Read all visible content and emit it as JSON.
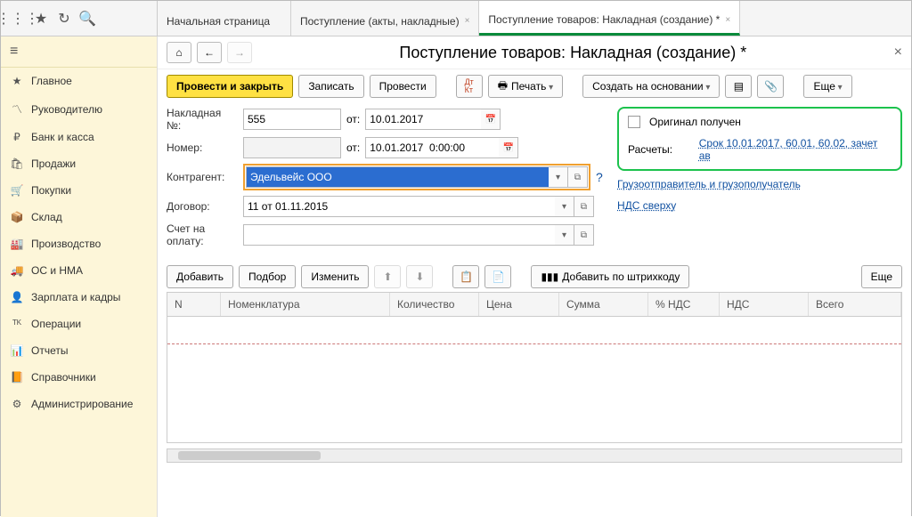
{
  "topTabs": {
    "t0": "Начальная страница",
    "t1": "Поступление (акты, накладные)",
    "t2": "Поступление товаров: Накладная (создание) *"
  },
  "sidebar": {
    "items": [
      {
        "label": "Главное"
      },
      {
        "label": "Руководителю"
      },
      {
        "label": "Банк и касса"
      },
      {
        "label": "Продажи"
      },
      {
        "label": "Покупки"
      },
      {
        "label": "Склад"
      },
      {
        "label": "Производство"
      },
      {
        "label": "ОС и НМА"
      },
      {
        "label": "Зарплата и кадры"
      },
      {
        "label": "Операции"
      },
      {
        "label": "Отчеты"
      },
      {
        "label": "Справочники"
      },
      {
        "label": "Администрирование"
      }
    ]
  },
  "page": {
    "title": "Поступление товаров: Накладная (создание) *"
  },
  "toolbar": {
    "postClose": "Провести и закрыть",
    "save": "Записать",
    "post": "Провести",
    "print": "Печать",
    "createBased": "Создать на основании",
    "more": "Еще"
  },
  "form": {
    "invoiceNoLabel": "Накладная №:",
    "invoiceNo": "555",
    "from1": "от:",
    "date1": "10.01.2017",
    "numberLabel": "Номер:",
    "from2": "от:",
    "date2": "10.01.2017  0:00:00",
    "contractorLabel": "Контрагент:",
    "contractor": "Эдельвейс ООО",
    "contractLabel": "Договор:",
    "contract": "11 от 01.11.2015",
    "billLabel": "Счет на оплату:"
  },
  "right": {
    "originalReceived": "Оригинал получен",
    "settlementsLabel": "Расчеты:",
    "settlementsLink": "Срок 10.01.2017, 60.01, 60.02, зачет ав",
    "consignorLink": "Грузоотправитель и грузополучатель",
    "vatLink": "НДС сверху"
  },
  "tableToolbar": {
    "add": "Добавить",
    "pick": "Подбор",
    "edit": "Изменить",
    "barcode": "Добавить по штрихкоду",
    "more": "Еще"
  },
  "grid": {
    "headers": {
      "n": "N",
      "nom": "Номенклатура",
      "qty": "Количество",
      "price": "Цена",
      "sum": "Сумма",
      "ndsP": "% НДС",
      "nds": "НДС",
      "total": "Всего"
    }
  }
}
